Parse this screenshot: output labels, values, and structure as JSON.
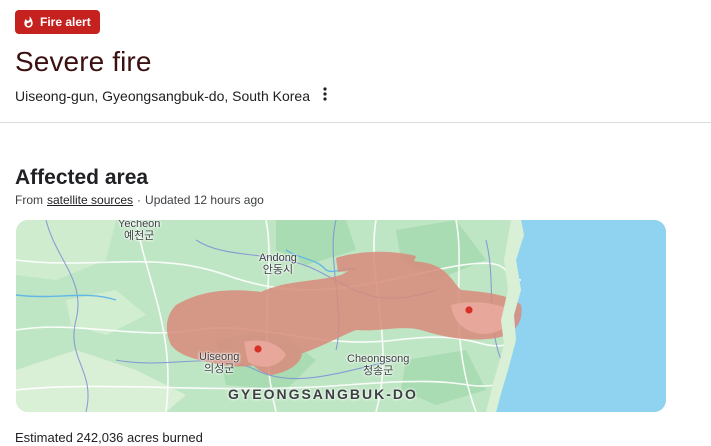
{
  "alert": {
    "label": "Fire alert",
    "icon": "fire-icon",
    "color": "#c5221f"
  },
  "header": {
    "title": "Severe fire",
    "location": "Uiseong-gun, Gyeongsangbuk-do, South Korea",
    "more_icon": "more-vert-icon"
  },
  "affected": {
    "title": "Affected area",
    "source_prefix": "From",
    "source_link": "satellite sources",
    "separator": "·",
    "updated": "Updated 12 hours ago"
  },
  "map": {
    "places": [
      {
        "name": "Yecheon",
        "korean": "예천군"
      },
      {
        "name": "Andong",
        "korean": "안동시"
      },
      {
        "name": "Uiseong",
        "korean": "의성군"
      },
      {
        "name": "Cheongsong",
        "korean": "청송군"
      }
    ],
    "region": "GYEONGSANGBUK-DO",
    "colors": {
      "burn_area": "#d98b7c",
      "land": "#bfe6c4",
      "sea": "#8fd3f0",
      "fire_dot": "#d93025"
    }
  },
  "estimate": "Estimated 242,036 acres burned"
}
